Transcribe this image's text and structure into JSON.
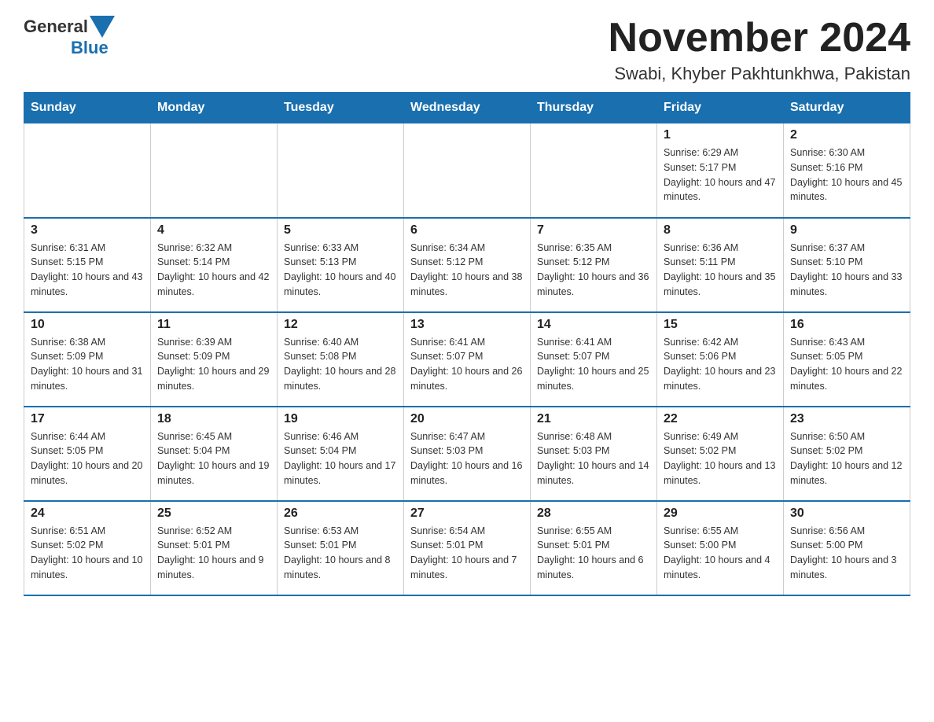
{
  "header": {
    "logo": {
      "general": "General",
      "blue": "Blue",
      "arrow": "▼"
    },
    "title": "November 2024",
    "subtitle": "Swabi, Khyber Pakhtunkhwa, Pakistan"
  },
  "days_of_week": [
    "Sunday",
    "Monday",
    "Tuesday",
    "Wednesday",
    "Thursday",
    "Friday",
    "Saturday"
  ],
  "weeks": [
    [
      {
        "day": "",
        "info": ""
      },
      {
        "day": "",
        "info": ""
      },
      {
        "day": "",
        "info": ""
      },
      {
        "day": "",
        "info": ""
      },
      {
        "day": "",
        "info": ""
      },
      {
        "day": "1",
        "info": "Sunrise: 6:29 AM\nSunset: 5:17 PM\nDaylight: 10 hours and 47 minutes."
      },
      {
        "day": "2",
        "info": "Sunrise: 6:30 AM\nSunset: 5:16 PM\nDaylight: 10 hours and 45 minutes."
      }
    ],
    [
      {
        "day": "3",
        "info": "Sunrise: 6:31 AM\nSunset: 5:15 PM\nDaylight: 10 hours and 43 minutes."
      },
      {
        "day": "4",
        "info": "Sunrise: 6:32 AM\nSunset: 5:14 PM\nDaylight: 10 hours and 42 minutes."
      },
      {
        "day": "5",
        "info": "Sunrise: 6:33 AM\nSunset: 5:13 PM\nDaylight: 10 hours and 40 minutes."
      },
      {
        "day": "6",
        "info": "Sunrise: 6:34 AM\nSunset: 5:12 PM\nDaylight: 10 hours and 38 minutes."
      },
      {
        "day": "7",
        "info": "Sunrise: 6:35 AM\nSunset: 5:12 PM\nDaylight: 10 hours and 36 minutes."
      },
      {
        "day": "8",
        "info": "Sunrise: 6:36 AM\nSunset: 5:11 PM\nDaylight: 10 hours and 35 minutes."
      },
      {
        "day": "9",
        "info": "Sunrise: 6:37 AM\nSunset: 5:10 PM\nDaylight: 10 hours and 33 minutes."
      }
    ],
    [
      {
        "day": "10",
        "info": "Sunrise: 6:38 AM\nSunset: 5:09 PM\nDaylight: 10 hours and 31 minutes."
      },
      {
        "day": "11",
        "info": "Sunrise: 6:39 AM\nSunset: 5:09 PM\nDaylight: 10 hours and 29 minutes."
      },
      {
        "day": "12",
        "info": "Sunrise: 6:40 AM\nSunset: 5:08 PM\nDaylight: 10 hours and 28 minutes."
      },
      {
        "day": "13",
        "info": "Sunrise: 6:41 AM\nSunset: 5:07 PM\nDaylight: 10 hours and 26 minutes."
      },
      {
        "day": "14",
        "info": "Sunrise: 6:41 AM\nSunset: 5:07 PM\nDaylight: 10 hours and 25 minutes."
      },
      {
        "day": "15",
        "info": "Sunrise: 6:42 AM\nSunset: 5:06 PM\nDaylight: 10 hours and 23 minutes."
      },
      {
        "day": "16",
        "info": "Sunrise: 6:43 AM\nSunset: 5:05 PM\nDaylight: 10 hours and 22 minutes."
      }
    ],
    [
      {
        "day": "17",
        "info": "Sunrise: 6:44 AM\nSunset: 5:05 PM\nDaylight: 10 hours and 20 minutes."
      },
      {
        "day": "18",
        "info": "Sunrise: 6:45 AM\nSunset: 5:04 PM\nDaylight: 10 hours and 19 minutes."
      },
      {
        "day": "19",
        "info": "Sunrise: 6:46 AM\nSunset: 5:04 PM\nDaylight: 10 hours and 17 minutes."
      },
      {
        "day": "20",
        "info": "Sunrise: 6:47 AM\nSunset: 5:03 PM\nDaylight: 10 hours and 16 minutes."
      },
      {
        "day": "21",
        "info": "Sunrise: 6:48 AM\nSunset: 5:03 PM\nDaylight: 10 hours and 14 minutes."
      },
      {
        "day": "22",
        "info": "Sunrise: 6:49 AM\nSunset: 5:02 PM\nDaylight: 10 hours and 13 minutes."
      },
      {
        "day": "23",
        "info": "Sunrise: 6:50 AM\nSunset: 5:02 PM\nDaylight: 10 hours and 12 minutes."
      }
    ],
    [
      {
        "day": "24",
        "info": "Sunrise: 6:51 AM\nSunset: 5:02 PM\nDaylight: 10 hours and 10 minutes."
      },
      {
        "day": "25",
        "info": "Sunrise: 6:52 AM\nSunset: 5:01 PM\nDaylight: 10 hours and 9 minutes."
      },
      {
        "day": "26",
        "info": "Sunrise: 6:53 AM\nSunset: 5:01 PM\nDaylight: 10 hours and 8 minutes."
      },
      {
        "day": "27",
        "info": "Sunrise: 6:54 AM\nSunset: 5:01 PM\nDaylight: 10 hours and 7 minutes."
      },
      {
        "day": "28",
        "info": "Sunrise: 6:55 AM\nSunset: 5:01 PM\nDaylight: 10 hours and 6 minutes."
      },
      {
        "day": "29",
        "info": "Sunrise: 6:55 AM\nSunset: 5:00 PM\nDaylight: 10 hours and 4 minutes."
      },
      {
        "day": "30",
        "info": "Sunrise: 6:56 AM\nSunset: 5:00 PM\nDaylight: 10 hours and 3 minutes."
      }
    ]
  ]
}
